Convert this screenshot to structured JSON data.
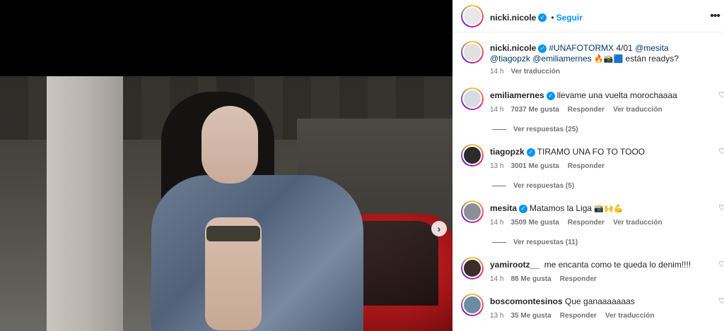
{
  "post": {
    "username": "nicki.nicole",
    "follow_label": "Seguir",
    "caption_hashtag": "#UNAFOTORMX",
    "caption_date": " 4/01 ",
    "caption_mention1": "@mesita",
    "caption_mention2": "@tiagopzk",
    "caption_mention3": "@emiliamernes",
    "caption_emojis": "🔥📸🟦",
    "caption_tail": " están readys?",
    "time": "14 h",
    "translate": "Ver traducción"
  },
  "comments": [
    {
      "username": "emiliamernes",
      "verified": true,
      "text": "llevame una vuelta morochaaaa",
      "time": "14 h",
      "likes": "7037 Me gusta",
      "reply": "Responder",
      "translate": "Ver traducción",
      "replies": "Ver respuestas (25)"
    },
    {
      "username": "tiagopzk",
      "verified": true,
      "text": "TIRAMO UNA FO TO TOOO",
      "time": "13 h",
      "likes": "3001 Me gusta",
      "reply": "Responder",
      "translate": "",
      "replies": "Ver respuestas (5)"
    },
    {
      "username": "mesita",
      "verified": true,
      "text": "Matamos la Liga",
      "emojis": "📸🙌💪",
      "time": "14 h",
      "likes": "3509 Me gusta",
      "reply": "Responder",
      "translate": "Ver traducción",
      "replies": "Ver respuestas (11)"
    },
    {
      "username": "yamirootz__",
      "verified": false,
      "text": "me encanta como te queda lo denim!!!!",
      "time": "14 h",
      "likes": "88 Me gusta",
      "reply": "Responder",
      "translate": ""
    },
    {
      "username": "boscomontesinos",
      "verified": false,
      "text": "Que ganaaaaaaas",
      "time": "13 h",
      "likes": "35 Me gusta",
      "reply": "Responder",
      "translate": "Ver traducción"
    }
  ],
  "icons": {
    "more": "more-options-icon",
    "heart": "heart-icon",
    "next": "chevron-right-icon",
    "verified": "verified-badge-icon"
  },
  "colors": {
    "link": "#0095f6",
    "mention": "#00376b",
    "muted": "#737373"
  }
}
